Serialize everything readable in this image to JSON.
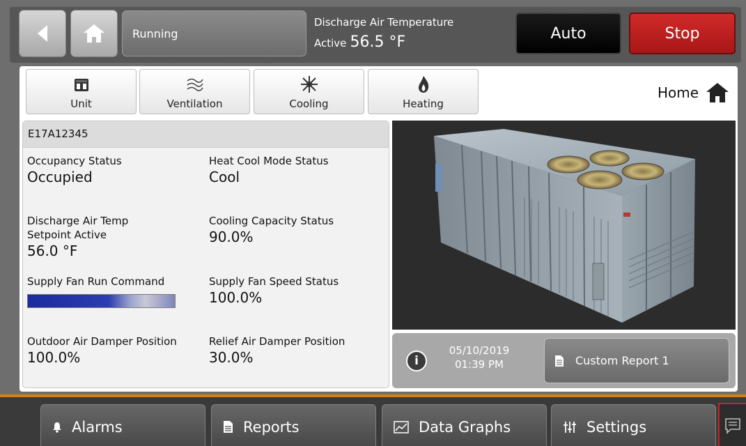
{
  "header": {
    "status": "Running",
    "discharge_label": "Discharge Air Temperature",
    "discharge_prefix": "Active",
    "discharge_value": "56.5 °F",
    "auto_label": "Auto",
    "stop_label": "Stop",
    "stop_color": "#c21f1f"
  },
  "tabs": [
    {
      "label": "Unit",
      "icon": "unit-icon"
    },
    {
      "label": "Ventilation",
      "icon": "ventilation-icon"
    },
    {
      "label": "Cooling",
      "icon": "snowflake-icon"
    },
    {
      "label": "Heating",
      "icon": "flame-icon"
    }
  ],
  "breadcrumb": {
    "label": "Home",
    "icon": "home-icon"
  },
  "status_card": {
    "unit_id": "E17A12345",
    "fields": {
      "occupancy": {
        "label": "Occupancy Status",
        "value": "Occupied"
      },
      "heat_cool": {
        "label": "Heat Cool Mode Status",
        "value": "Cool"
      },
      "dat_setpoint": {
        "label_line1": "Discharge Air Temp",
        "label_line2": "Setpoint Active",
        "value": "56.0 °F"
      },
      "cooling_capacity": {
        "label": "Cooling Capacity Status",
        "value": "90.0%"
      },
      "supply_fan_cmd": {
        "label": "Supply Fan Run Command"
      },
      "supply_fan_speed": {
        "label": "Supply Fan Speed Status",
        "value": "100.0%"
      },
      "oa_damper": {
        "label": "Outdoor Air Damper Position",
        "value": "100.0%"
      },
      "relief_damper": {
        "label": "Relief Air Damper Position",
        "value": "30.0%"
      }
    }
  },
  "info": {
    "date": "05/10/2019",
    "time": "01:39 PM",
    "report_label": "Custom Report 1"
  },
  "bottom_nav": [
    {
      "label": "Alarms",
      "icon": "bell-icon"
    },
    {
      "label": "Reports",
      "icon": "document-icon"
    },
    {
      "label": "Data Graphs",
      "icon": "graph-icon"
    },
    {
      "label": "Settings",
      "icon": "sliders-icon"
    }
  ],
  "accent_color": "#d87a1e"
}
